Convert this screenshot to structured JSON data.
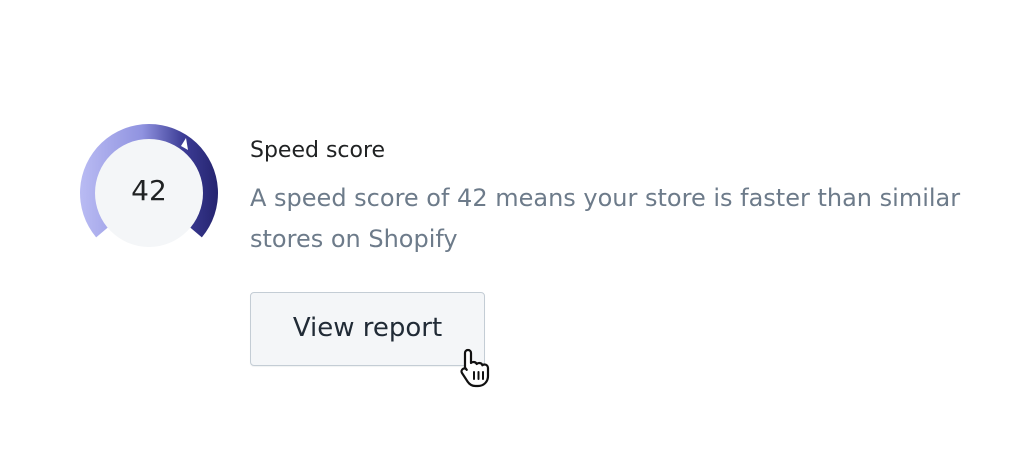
{
  "speed_score": {
    "value": "42",
    "score": 42,
    "title": "Speed score",
    "description": "A speed score of 42 means your store is faster than similar stores on Shopify",
    "button_label": "View report"
  },
  "colors": {
    "gauge_light": "#b3b5ef",
    "gauge_dark": "#2d2d7e",
    "gauge_inner": "#f4f6f8",
    "title_text": "#202223",
    "description_text": "#6d7b8a",
    "button_bg": "#f4f6f8",
    "button_border": "#c4cdd5"
  },
  "cursor": {
    "icon": "hand-pointer-icon"
  }
}
